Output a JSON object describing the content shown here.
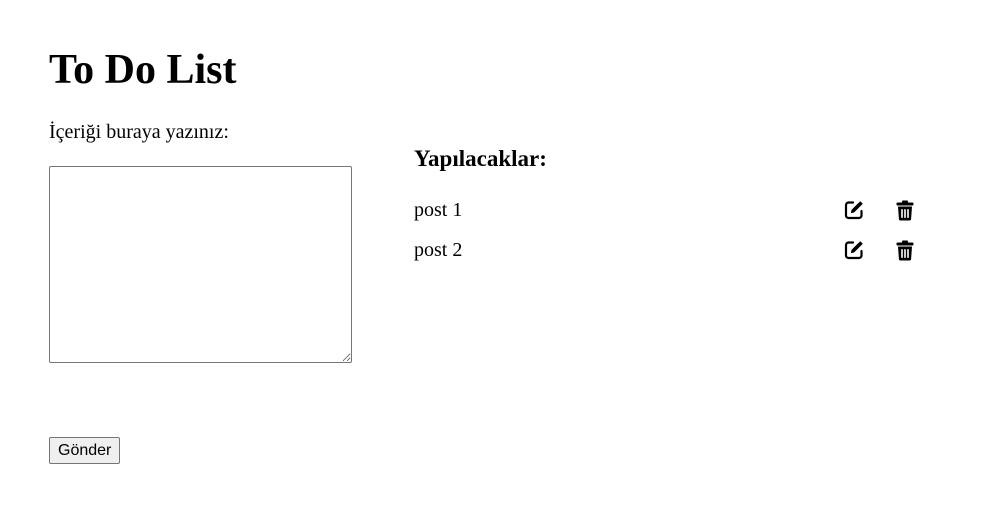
{
  "page": {
    "title": "To Do List"
  },
  "form": {
    "label": "İçeriği buraya yazınız:",
    "textarea_value": "",
    "submit_label": "Gönder"
  },
  "todos": {
    "heading": "Yapılacaklar:",
    "items": [
      {
        "text": "post 1",
        "edit_icon": "edit-icon",
        "delete_icon": "trash-icon"
      },
      {
        "text": "post 2",
        "edit_icon": "edit-icon",
        "delete_icon": "trash-icon"
      }
    ]
  }
}
